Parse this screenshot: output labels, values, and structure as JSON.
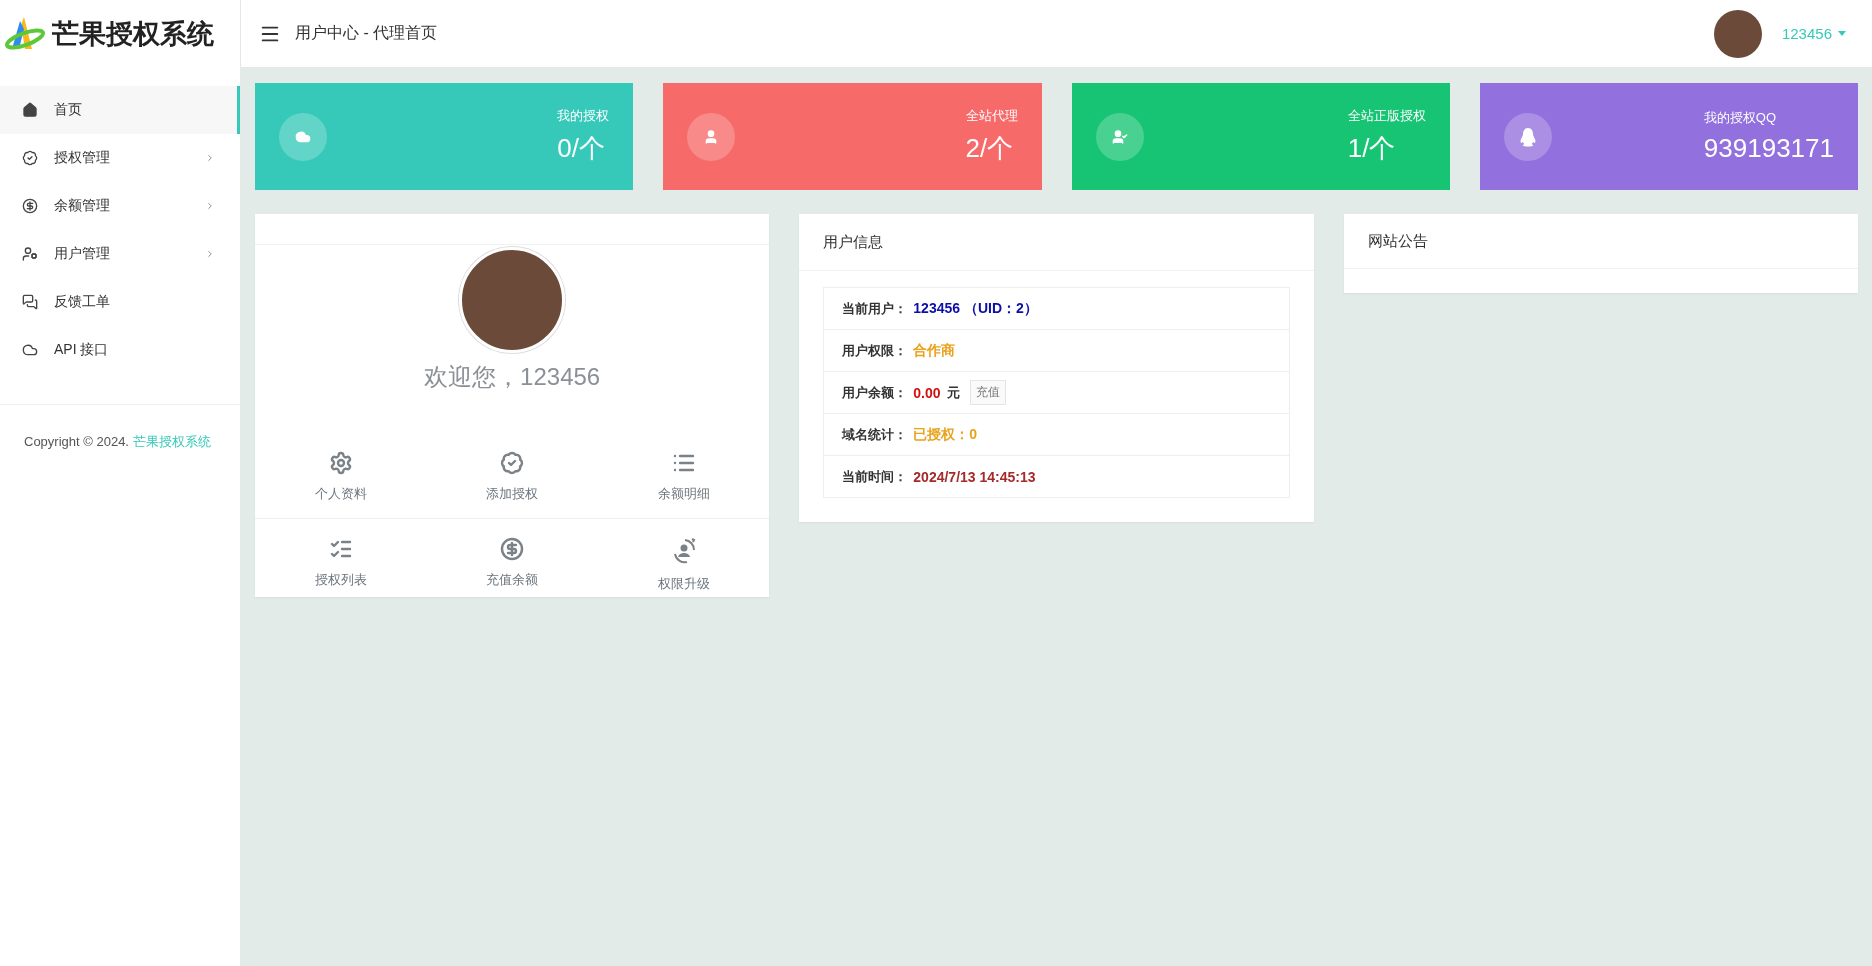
{
  "brand": {
    "name": "芒果授权系统"
  },
  "sidebar": {
    "items": [
      {
        "label": "首页",
        "selected": true,
        "has_submenu": false
      },
      {
        "label": "授权管理",
        "selected": false,
        "has_submenu": true
      },
      {
        "label": "余额管理",
        "selected": false,
        "has_submenu": true
      },
      {
        "label": "用户管理",
        "selected": false,
        "has_submenu": true
      },
      {
        "label": "反馈工单",
        "selected": false,
        "has_submenu": false
      },
      {
        "label": "API 接口",
        "selected": false,
        "has_submenu": false
      }
    ],
    "footer": {
      "text": "Copyright © 2024.",
      "link": "芒果授权系统"
    }
  },
  "header": {
    "breadcrumb": "用户中心 - 代理首页",
    "username": "123456"
  },
  "stats": [
    {
      "label": "我的授权",
      "value": "0/个",
      "color": "#36c9b9"
    },
    {
      "label": "全站代理",
      "value": "2/个",
      "color": "#f76a6a"
    },
    {
      "label": "全站正版授权",
      "value": "1/个",
      "color": "#17c474"
    },
    {
      "label": "我的授权QQ",
      "value": "939193171",
      "color": "#9270dd"
    }
  ],
  "profile": {
    "welcome": "欢迎您，123456",
    "actions": [
      "个人资料",
      "添加授权",
      "余额明细",
      "授权列表",
      "充值余额",
      "权限升级"
    ]
  },
  "user_info": {
    "title": "用户信息",
    "rows": [
      {
        "label": "当前用户：",
        "value": "123456 （UID：2）",
        "color": "#0b0fa8"
      },
      {
        "label": "用户权限：",
        "value": "合作商",
        "color": "#e8a21c"
      },
      {
        "label": "用户余额：",
        "value": "0.00",
        "color": "#d40f0f",
        "unit": "元",
        "action": "充值"
      },
      {
        "label": "域名统计：",
        "value": "已授权：0",
        "color": "#e8a21c"
      },
      {
        "label": "当前时间：",
        "value": "2024/7/13 14:45:13",
        "color": "#a52a2a"
      }
    ]
  },
  "notice": {
    "title": "网站公告"
  }
}
